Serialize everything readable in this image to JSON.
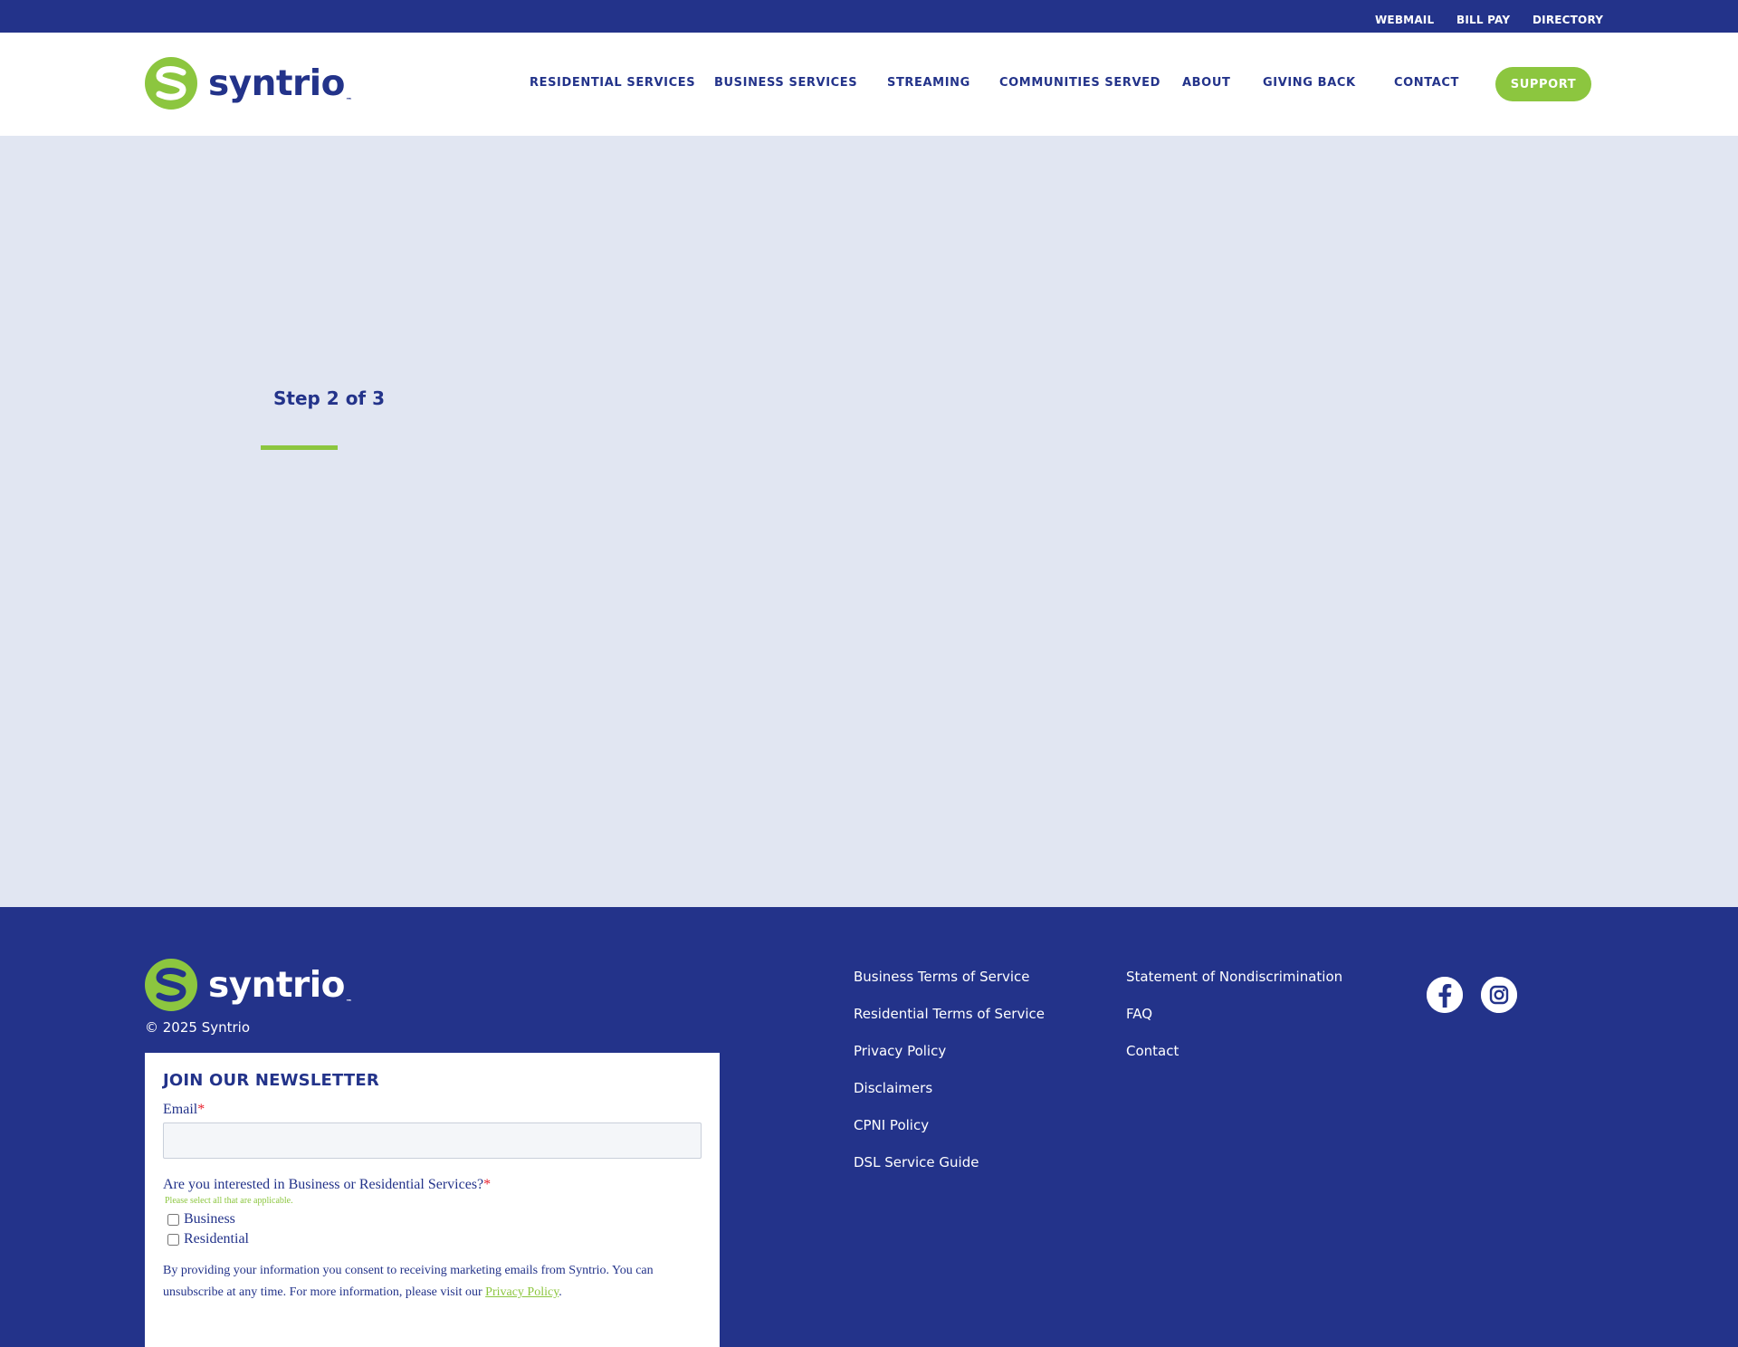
{
  "utility_bar": {
    "links": [
      "WEBMAIL",
      "BILL PAY",
      "DIRECTORY"
    ]
  },
  "brand": {
    "name": "syntrio",
    "tm": "™",
    "colors": {
      "primary": "#23338a",
      "accent": "#8cc63f",
      "background": "#e1e6f2"
    }
  },
  "nav": {
    "items": [
      "RESIDENTIAL SERVICES",
      "BUSINESS SERVICES",
      "STREAMING",
      "COMMUNITIES SERVED",
      "ABOUT",
      "GIVING BACK",
      "CONTACT"
    ],
    "support_label": "SUPPORT"
  },
  "main": {
    "step_text": "Step 2 of 3"
  },
  "footer": {
    "copyright": "© 2025 Syntrio",
    "links_col1": [
      "Business Terms of Service",
      "Residential Terms of Service",
      "Privacy Policy",
      "Disclaimers",
      "CPNI Policy",
      "DSL Service Guide"
    ],
    "links_col2": [
      "Statement of Nondiscrimination",
      "FAQ",
      "Contact"
    ],
    "social": [
      "facebook-icon",
      "instagram-icon"
    ]
  },
  "newsletter": {
    "title": "JOIN OUR NEWSLETTER",
    "email_label": "Email",
    "required_mark": "*",
    "email_value": "",
    "question": "Are you interested in Business or Residential Services?",
    "hint": "Please select all that are applicable.",
    "options": [
      "Business",
      "Residential"
    ],
    "consent_text": "By providing your information you consent to receiving marketing emails from Syntrio. You can unsubscribe at any time. For more information, please visit our ",
    "consent_link": "Privacy Policy",
    "consent_end": "."
  }
}
